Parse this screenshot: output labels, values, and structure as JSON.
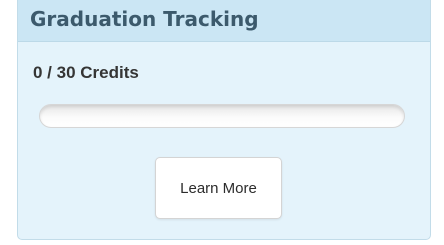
{
  "panel": {
    "title": "Graduation Tracking",
    "credits_text": "0 / 30 Credits",
    "progress": {
      "completed_credits": 0,
      "total_credits": 30,
      "fraction": 0
    },
    "learn_more_label": "Learn More"
  },
  "colors": {
    "panel_background": "#e4f3fb",
    "header_background": "#cbe6f4",
    "title_text": "#3c5a6c",
    "progress_fill": "#7cc24f"
  }
}
